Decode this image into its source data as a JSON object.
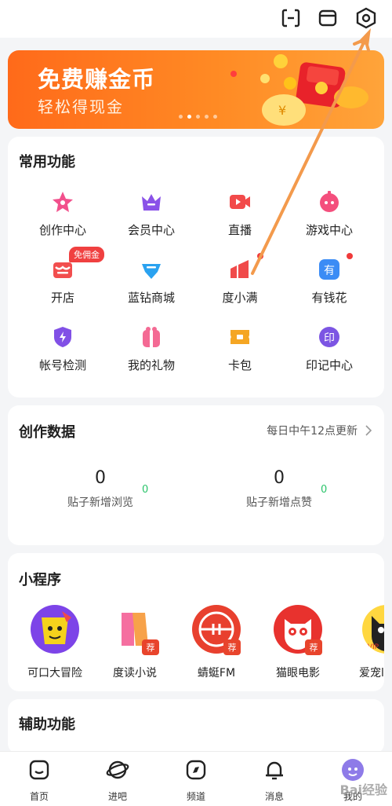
{
  "banner": {
    "title": "免费赚金币",
    "subtitle": "轻松得现金",
    "active_dot": 1,
    "dot_count": 5
  },
  "common": {
    "title": "常用功能",
    "items": [
      {
        "label": "创作中心",
        "icon": "star-icon",
        "color": "#f2508c"
      },
      {
        "label": "会员中心",
        "icon": "crown-icon",
        "color": "#8a52e8"
      },
      {
        "label": "直播",
        "icon": "video-camera-icon",
        "color": "#f24a4a"
      },
      {
        "label": "游戏中心",
        "icon": "gamepad-icon",
        "color": "#f44f7d"
      },
      {
        "label": "开店",
        "icon": "shop-icon",
        "color": "#f24e4e",
        "tag": "免佣金"
      },
      {
        "label": "蓝钻商城",
        "icon": "diamond-icon",
        "color": "#2aa2f0"
      },
      {
        "label": "度小满",
        "icon": "du-xiaoman-icon",
        "color": "#f04a4a",
        "reddot": true
      },
      {
        "label": "有钱花",
        "icon": "money-flower-icon",
        "color": "#3b8cf5",
        "reddot": true
      },
      {
        "label": "帐号检测",
        "icon": "shield-check-icon",
        "color": "#8150e6"
      },
      {
        "label": "我的礼物",
        "icon": "gift-icon",
        "color": "#f46a94"
      },
      {
        "label": "卡包",
        "icon": "ticket-icon",
        "color": "#f5a623"
      },
      {
        "label": "印记中心",
        "icon": "seal-icon",
        "color": "#7c55e3"
      }
    ]
  },
  "creation": {
    "title": "创作数据",
    "update_note": "每日中午12点更新",
    "stats": [
      {
        "value": "0",
        "label": "贴子新增浏览",
        "increase": "0"
      },
      {
        "value": "0",
        "label": "贴子新增点赞",
        "increase": "0"
      }
    ]
  },
  "mini": {
    "title": "小程序",
    "items": [
      {
        "label": "可口大冒险",
        "icon": "snack-adventure-icon"
      },
      {
        "label": "度读小说",
        "icon": "book-icon",
        "rec": "荐"
      },
      {
        "label": "蜻蜓FM",
        "icon": "radio-icon",
        "rec": "荐"
      },
      {
        "label": "猫眼电影",
        "icon": "cat-eye-icon",
        "rec": "荐"
      },
      {
        "label": "爱宠l",
        "icon": "pet-icon"
      }
    ]
  },
  "assist": {
    "title": "辅助功能"
  },
  "nav": {
    "items": [
      {
        "label": "首页",
        "icon": "home-icon"
      },
      {
        "label": "进吧",
        "icon": "planet-icon"
      },
      {
        "label": "频道",
        "icon": "compass-icon"
      },
      {
        "label": "消息",
        "icon": "bell-icon"
      },
      {
        "label": "我的",
        "icon": "avatar-icon"
      }
    ]
  },
  "watermark": "Bai经验"
}
